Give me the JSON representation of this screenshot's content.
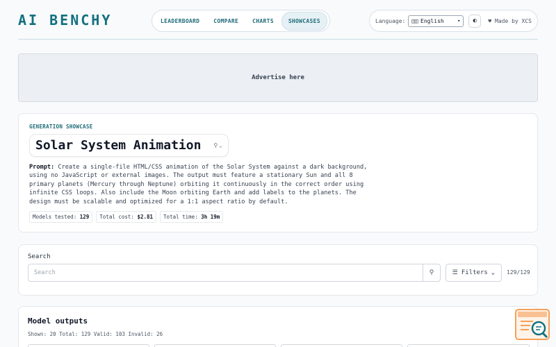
{
  "header": {
    "logo": "AI BENCHY",
    "nav": [
      "LEADERBOARD",
      "COMPARE",
      "CHARTS",
      "SHOWCASES"
    ],
    "active_nav": "SHOWCASES",
    "language_label": "Language:",
    "language_value": "English",
    "made_by": "Made by XCS"
  },
  "ad": {
    "text": "Advertise here"
  },
  "showcase": {
    "eyebrow": "GENERATION SHOWCASE",
    "title": "Solar System Animation",
    "prompt_label": "Prompt:",
    "prompt_text": "Create a single-file HTML/CSS animation of the Solar System against a dark background, using no JavaScript or external images. The output must feature a stationary Sun and all 8 primary planets (Mercury through Neptune) orbiting it continuously in the correct order using infinite CSS loops. Also include the Moon orbiting Earth and add labels to the planets. The design must be scalable and optimized for a 1:1 aspect ratio by default.",
    "stats": [
      {
        "label": "Models tested:",
        "value": "129"
      },
      {
        "label": "Total cost:",
        "value": "$2.81"
      },
      {
        "label": "Total time:",
        "value": "3h 19m"
      }
    ]
  },
  "search": {
    "label": "Search",
    "placeholder": "Search",
    "filters_label": "Filters",
    "count": "129/129"
  },
  "outputs": {
    "title": "Model outputs",
    "summary": "Shown: 20 Total: 129 Valid: 103 Invalid: 26"
  },
  "colors": {
    "brand": "#13707f",
    "accent": "#f5a05a"
  }
}
